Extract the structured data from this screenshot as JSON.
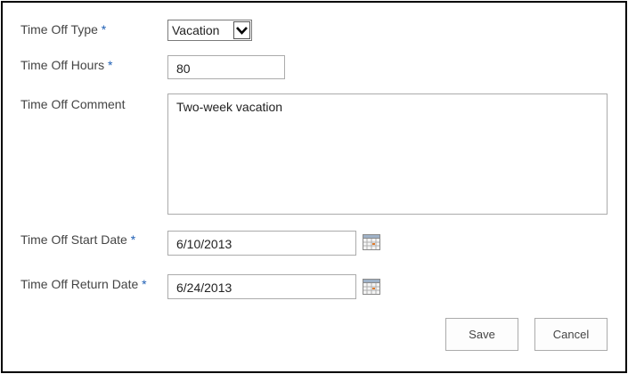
{
  "form": {
    "time_off_type": {
      "label": "Time Off Type",
      "required_marker": "*",
      "selected_value": "Vacation"
    },
    "time_off_hours": {
      "label": "Time Off Hours",
      "required_marker": "*",
      "value": "80"
    },
    "time_off_comment": {
      "label": "Time Off Comment",
      "value": "Two-week vacation"
    },
    "time_off_start_date": {
      "label": "Time Off Start Date",
      "required_marker": "*",
      "value": "6/10/2013",
      "icon": "calendar-icon"
    },
    "time_off_return_date": {
      "label": "Time Off Return Date",
      "required_marker": "*",
      "value": "6/24/2013",
      "icon": "calendar-icon"
    }
  },
  "actions": {
    "save_label": "Save",
    "cancel_label": "Cancel"
  },
  "colors": {
    "label_text": "#444444",
    "required_marker": "#1f5fb4",
    "field_border": "#ababab",
    "frame_border": "#000000"
  }
}
